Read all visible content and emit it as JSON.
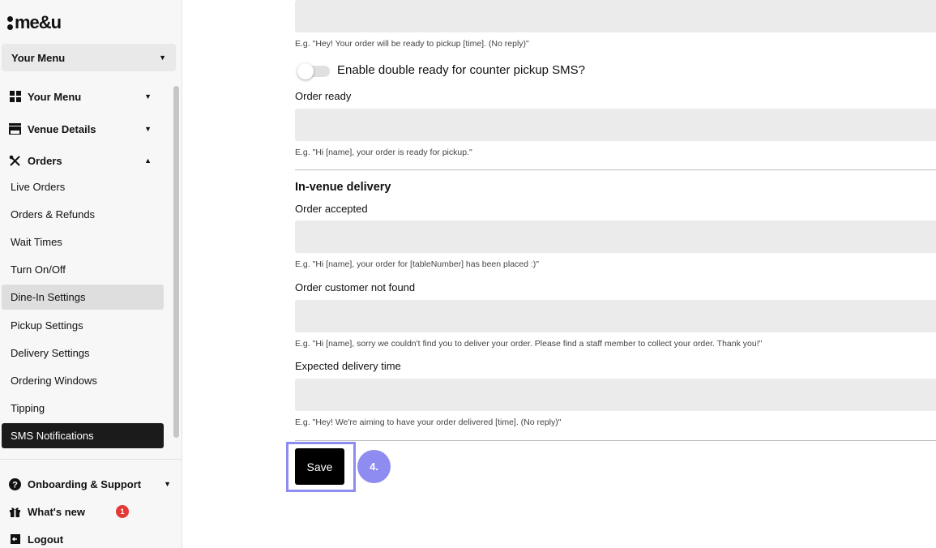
{
  "brand": {
    "logo_text": "me&u"
  },
  "sidebar": {
    "menu_select": "Your Menu",
    "groups": [
      {
        "label": "Your Menu",
        "icon": "grid-icon"
      },
      {
        "label": "Venue Details",
        "icon": "storefront-icon"
      },
      {
        "label": "Orders",
        "icon": "utensils-icon"
      }
    ],
    "order_items": [
      "Live Orders",
      "Orders & Refunds",
      "Wait Times",
      "Turn On/Off",
      "Dine-In Settings",
      "Pickup Settings",
      "Delivery Settings",
      "Ordering Windows",
      "Tipping",
      "SMS Notifications"
    ],
    "bottom": {
      "support": "Onboarding & Support",
      "whats_new": "What's new",
      "whats_new_badge": "1",
      "logout": "Logout"
    }
  },
  "main": {
    "pickup_hint_top": "E.g. \"Hey! Your order will be ready to pickup [time]. (No reply)\"",
    "double_ready_toggle": {
      "label": "Enable double ready for counter pickup SMS?",
      "enabled": false
    },
    "order_ready": {
      "label": "Order ready",
      "hint": "E.g. \"Hi [name], your order is ready for pickup.\""
    },
    "in_venue": {
      "title": "In-venue delivery",
      "order_accepted": {
        "label": "Order accepted",
        "hint": "E.g. \"Hi [name], your order for [tableNumber] has been placed :)\""
      },
      "customer_not_found": {
        "label": "Order customer not found",
        "hint": "E.g. \"Hi [name], sorry we couldn't find you to deliver your order. Please find a staff member to collect your order. Thank you!\""
      },
      "expected_time": {
        "label": "Expected delivery time",
        "hint": "E.g. \"Hey! We're aiming to have your order delivered [time]. (No reply)\""
      }
    },
    "save_label": "Save",
    "step_marker": "4."
  }
}
